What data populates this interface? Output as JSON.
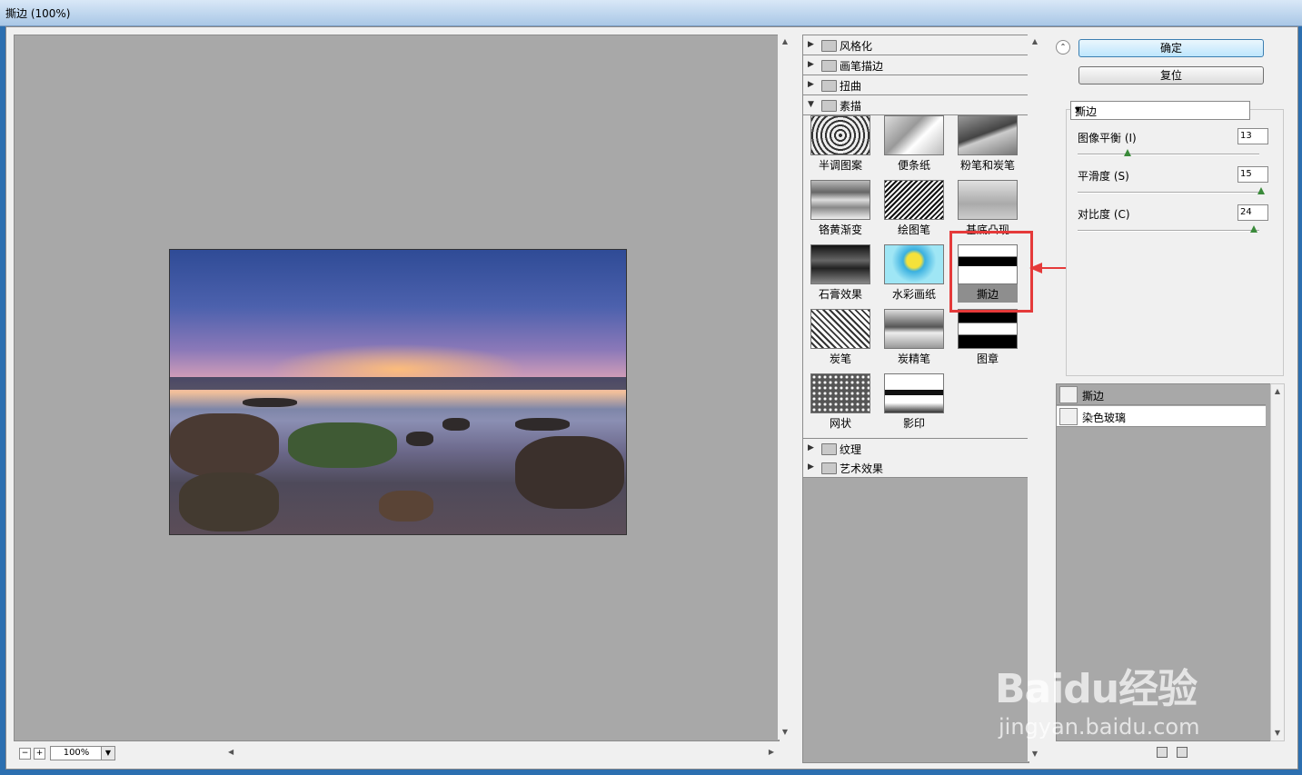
{
  "window": {
    "title": "撕边 (100%)"
  },
  "preview": {
    "zoom": "100%"
  },
  "gallery": {
    "categories_top": [
      "风格化",
      "画笔描边",
      "扭曲"
    ],
    "open_category": "素描",
    "thumbs": [
      "半调图案",
      "便条纸",
      "粉笔和炭笔",
      "铬黄渐变",
      "绘图笔",
      "基底凸现",
      "石膏效果",
      "水彩画纸",
      "撕边",
      "炭笔",
      "炭精笔",
      "图章",
      "网状",
      "影印"
    ],
    "selected_thumb": "撕边",
    "categories_bottom": [
      "纹理",
      "艺术效果"
    ]
  },
  "actions": {
    "ok": "确定",
    "reset": "复位"
  },
  "settings": {
    "filter": "撕边",
    "params": [
      {
        "label": "图像平衡 (I)",
        "value": "13"
      },
      {
        "label": "平滑度 (S)",
        "value": "15"
      },
      {
        "label": "对比度 (C)",
        "value": "24"
      }
    ]
  },
  "layers": [
    "撕边",
    "染色玻璃"
  ],
  "watermark": {
    "logo": "Baidu经验",
    "url": "jingyan.baidu.com"
  },
  "colors": {
    "highlight": "#e53a3a",
    "canvas": "#a8a8a8",
    "panel": "#f0f0f0"
  }
}
